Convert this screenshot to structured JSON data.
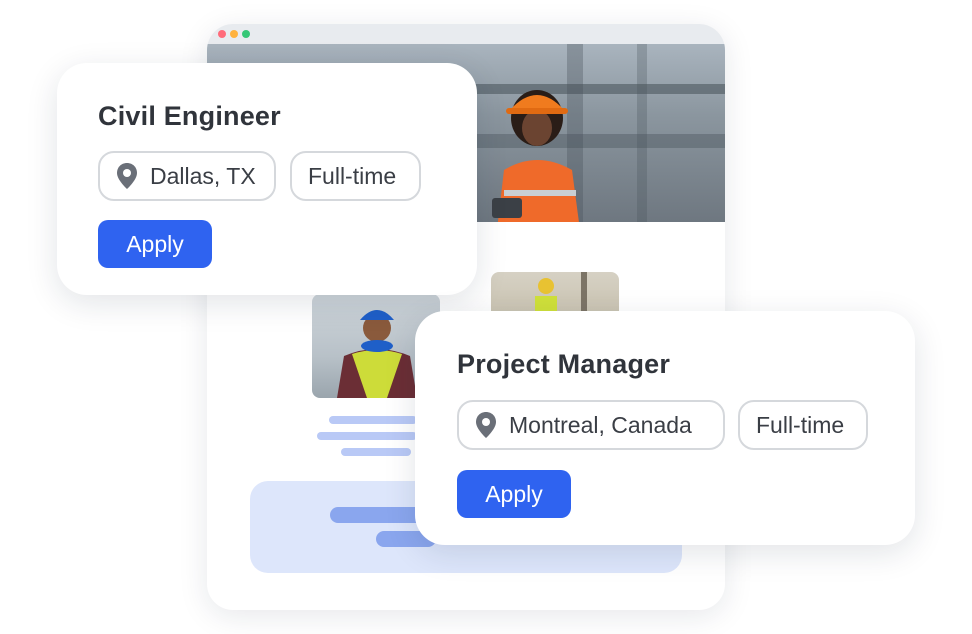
{
  "jobs": [
    {
      "title": "Civil Engineer",
      "location": "Dallas, TX",
      "type": "Full-time",
      "apply_label": "Apply"
    },
    {
      "title": "Project Manager",
      "location": "Montreal, Canada",
      "type": "Full-time",
      "apply_label": "Apply"
    }
  ],
  "colors": {
    "accent": "#2f63f0",
    "chip_border": "#d5d8dc",
    "promo_bg": "#dde6fb",
    "promo_bar": "#8aa6ee",
    "text_line": "#b9c9f6"
  },
  "icons": [
    "location-pin-icon"
  ]
}
